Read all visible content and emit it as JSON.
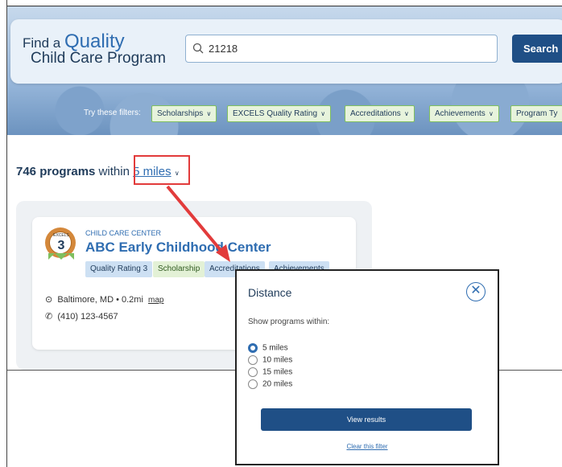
{
  "header": {
    "brand_prefix": "Find a",
    "brand_quality": "Quality",
    "brand_line2": "Child Care Program",
    "search_value": "21218",
    "search_button": "Search",
    "filters_label": "Try these filters:",
    "filters": [
      {
        "label": "Scholarships"
      },
      {
        "label": "EXCELS Quality Rating"
      },
      {
        "label": "Accreditations"
      },
      {
        "label": "Achievements"
      },
      {
        "label": "Program Ty"
      }
    ]
  },
  "results": {
    "count_text": "746 programs",
    "within_text": " within ",
    "distance_link": "5 miles"
  },
  "program": {
    "badge_text": "EXCELS",
    "badge_level": "3",
    "type": "CHILD CARE CENTER",
    "name": "ABC Early Childhood Center",
    "tags": [
      {
        "label": "Quality Rating 3"
      },
      {
        "label": "Scholarship"
      },
      {
        "label": "Accreditations"
      },
      {
        "label": "Achievements"
      }
    ],
    "location": "Baltimore, MD • 0.2mi",
    "map_link": "map",
    "phone": "(410) 123-4567"
  },
  "distance_popover": {
    "title": "Distance",
    "subtitle": "Show programs within:",
    "options": [
      {
        "label": "5 miles",
        "selected": true
      },
      {
        "label": "10 miles",
        "selected": false
      },
      {
        "label": "15 miles",
        "selected": false
      },
      {
        "label": "20 miles",
        "selected": false
      }
    ],
    "view_button": "View results",
    "clear_link": "Clear this filter"
  },
  "colors": {
    "accent": "#2f6db1",
    "primary_button": "#1f4f86",
    "highlight": "#e23b3b"
  }
}
